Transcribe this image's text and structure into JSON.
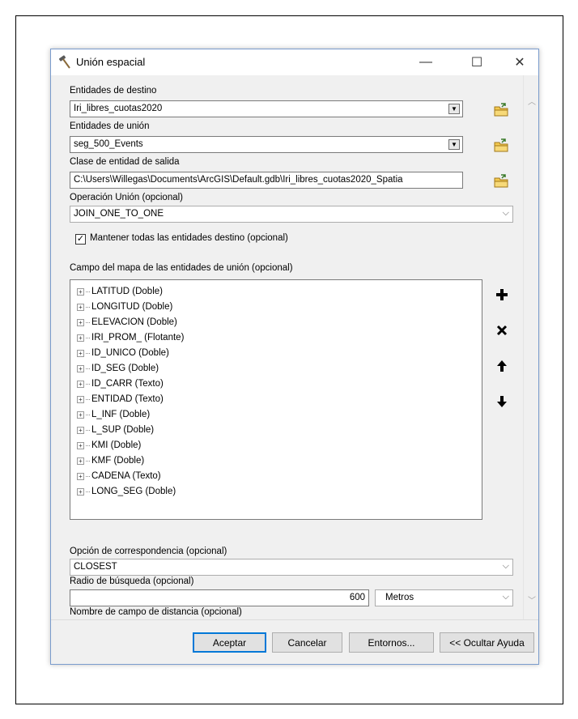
{
  "window": {
    "title": "Unión espacial",
    "minimize": "—",
    "maximize": "☐",
    "close": "✕"
  },
  "form": {
    "target_label": "Entidades de destino",
    "target_value": "Iri_libres_cuotas2020",
    "join_label": "Entidades de unión",
    "join_value": "seg_500_Events",
    "output_label": "Clase de entidad de salida",
    "output_value": "C:\\Users\\Willegas\\Documents\\ArcGIS\\Default.gdb\\Iri_libres_cuotas2020_Spatia",
    "operation_label": "Operación Unión (opcional)",
    "operation_value": "JOIN_ONE_TO_ONE",
    "keep_all_label": "Mantener todas las entidades destino (opcional)",
    "keep_all_checked": true,
    "fieldmap_label": "Campo del mapa de las entidades de unión (opcional)",
    "fieldmap_items": [
      "LATITUD (Doble)",
      "LONGITUD (Doble)",
      "ELEVACION (Doble)",
      "IRI_PROM_ (Flotante)",
      "ID_UNICO (Doble)",
      "ID_SEG (Doble)",
      "ID_CARR (Texto)",
      "ENTIDAD (Texto)",
      "L_INF (Doble)",
      "L_SUP (Doble)",
      "KMI (Doble)",
      "KMF (Doble)",
      "CADENA (Texto)",
      "LONG_SEG (Doble)"
    ],
    "match_label": "Opción de correspondencia (opcional)",
    "match_value": "CLOSEST",
    "radius_label": "Radio de búsqueda (opcional)",
    "radius_value": "600",
    "radius_unit": "Metros",
    "distance_label": "Nombre de campo de distancia (opcional)",
    "distance_value": ""
  },
  "buttons": {
    "ok": "Aceptar",
    "cancel": "Cancelar",
    "environments": "Entornos...",
    "help": "<< Ocultar Ayuda"
  },
  "icons": {
    "title": "hammer-icon",
    "browse": "open-folder-icon",
    "add": "plus-icon",
    "remove": "delete-x-icon",
    "up": "arrow-up-icon",
    "down": "arrow-down-icon"
  }
}
